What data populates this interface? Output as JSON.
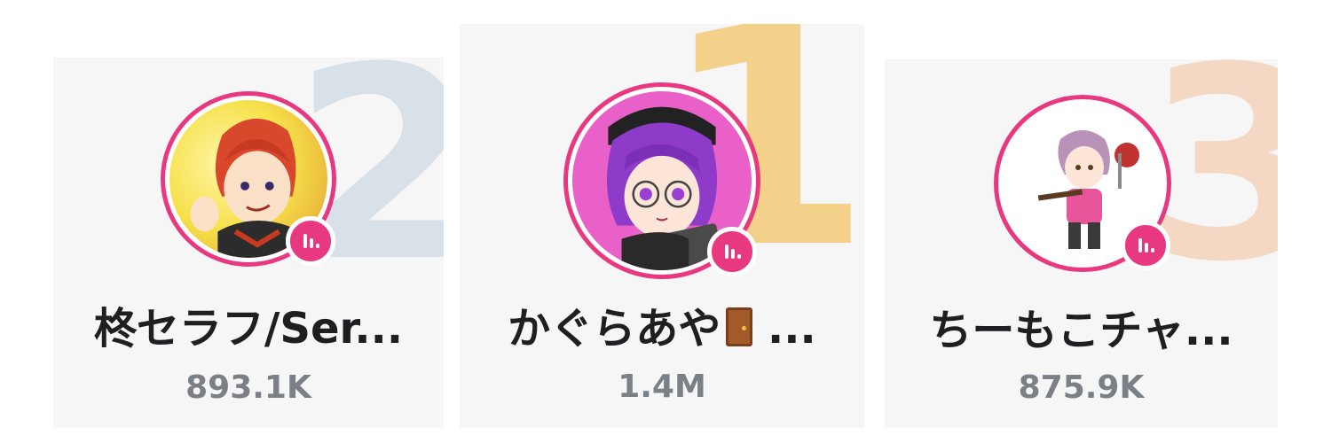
{
  "ranking": [
    {
      "rank": "2",
      "name": "柊セラフ/Ser...",
      "followers": "893.1K"
    },
    {
      "rank": "1",
      "name_text": "かぐらあや",
      "name_emoji": "door-emoji",
      "name_suffix": " ...",
      "followers": "1.4M"
    },
    {
      "rank": "3",
      "name": "ちーもこチャ...",
      "followers": "875.9K"
    }
  ],
  "colors": {
    "accent": "#e8387f",
    "card_bg": "#f6f6f7",
    "rank1": "#f4d18a",
    "rank2": "#d9e1e8",
    "rank3": "#f4d8c4"
  },
  "icons": {
    "live_badge": "audio-bars-icon"
  }
}
